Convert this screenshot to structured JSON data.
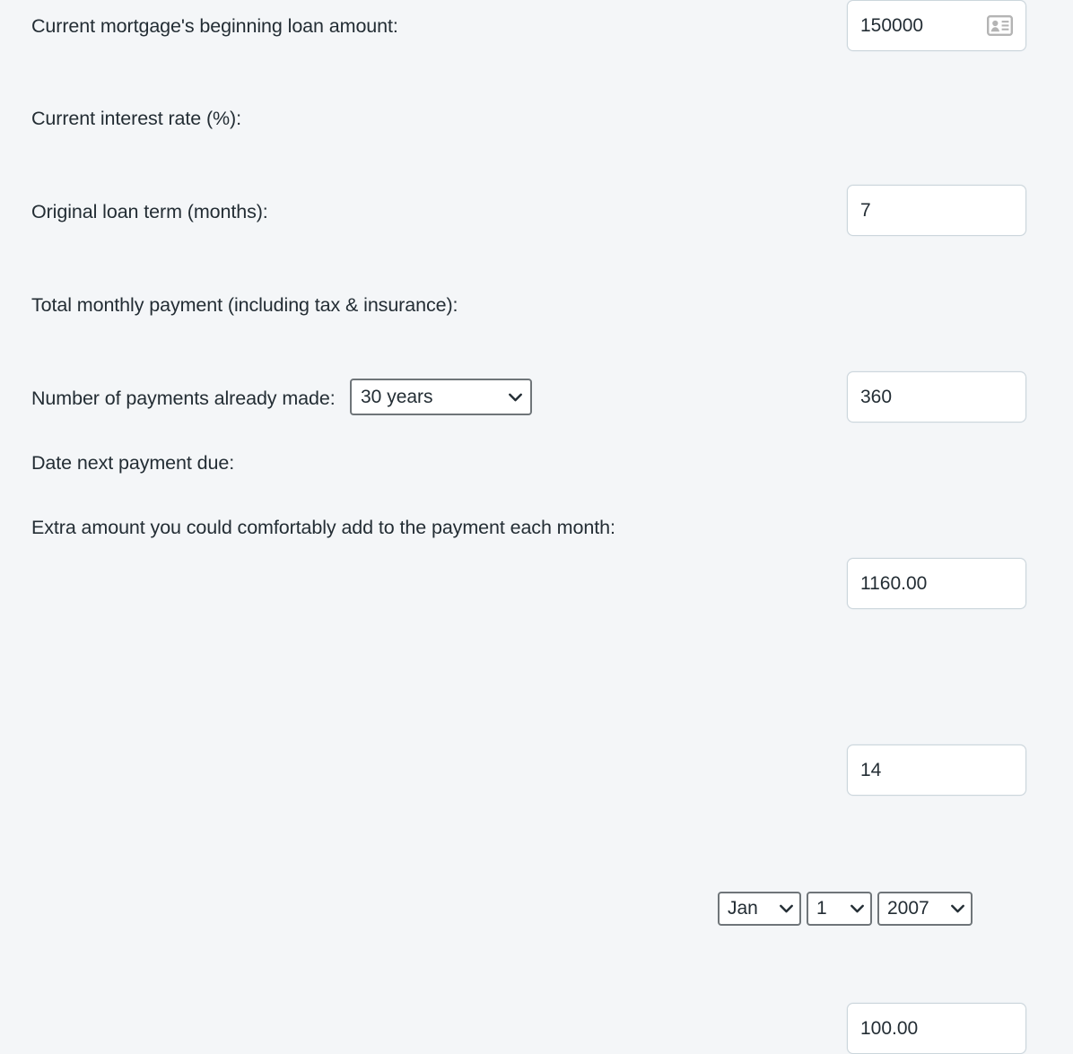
{
  "page": {
    "background_color": "#f4f6f8",
    "text_color": "#232d34",
    "input_border_color": "#ccd6dc",
    "select_border_color": "#6f7579"
  },
  "form": {
    "rows": [
      {
        "label": "Current mortgage's beginning loan amount:",
        "value": "150000",
        "icon": "contact-card-autofill-icon"
      },
      {
        "label": "Current interest rate (%):",
        "value": "7"
      },
      {
        "label": "Original loan term (months):",
        "select_value": "30 years",
        "value": "360"
      },
      {
        "label": "Total monthly payment (including tax & insurance):",
        "value": "1160.00"
      },
      {
        "label": "Number of payments already made:",
        "value": "14"
      },
      {
        "label": "Date next payment due:",
        "date": {
          "month": "Jan",
          "day": "1",
          "year": "2007"
        }
      },
      {
        "label": "Extra amount you could comfortably add to the payment each month:",
        "value": "100.00"
      }
    ]
  }
}
